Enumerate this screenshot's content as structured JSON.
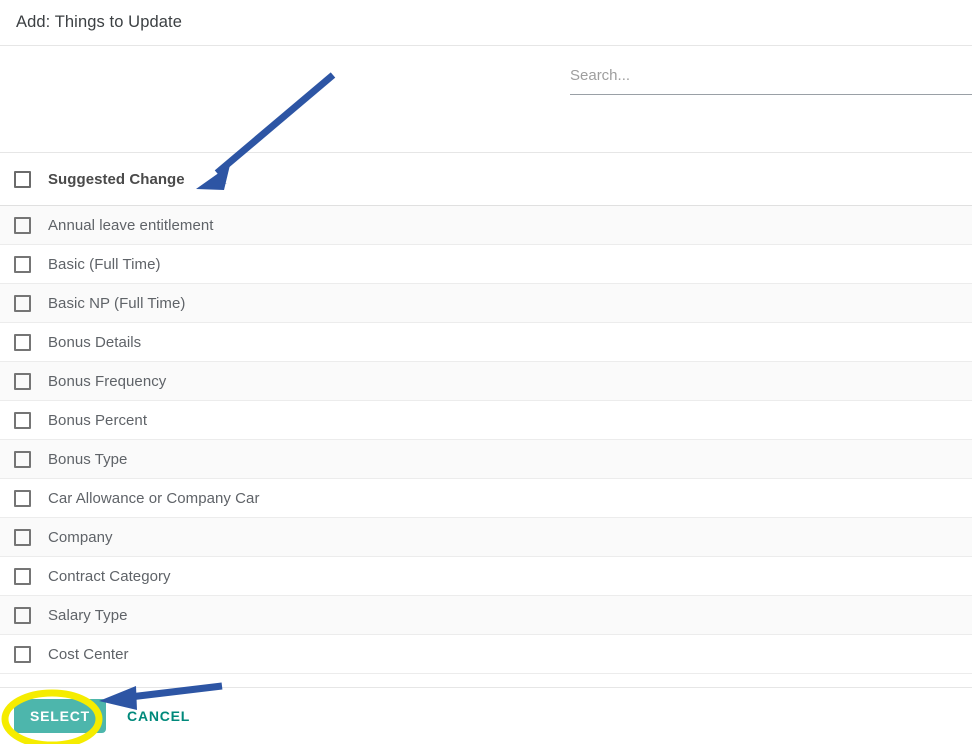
{
  "dialog": {
    "title": "Add: Things to Update"
  },
  "search": {
    "placeholder": "Search...",
    "value": ""
  },
  "table": {
    "header": {
      "label": "Suggested Change",
      "select_all_checked": false
    },
    "rows": [
      {
        "label": "Annual leave entitlement",
        "checked": false
      },
      {
        "label": "Basic (Full Time)",
        "checked": false
      },
      {
        "label": "Basic NP (Full Time)",
        "checked": false
      },
      {
        "label": "Bonus Details",
        "checked": false
      },
      {
        "label": "Bonus Frequency",
        "checked": false
      },
      {
        "label": "Bonus Percent",
        "checked": false
      },
      {
        "label": "Bonus Type",
        "checked": false
      },
      {
        "label": "Car Allowance or Company Car",
        "checked": false
      },
      {
        "label": "Company",
        "checked": false
      },
      {
        "label": "Contract Category",
        "checked": false
      },
      {
        "label": "Salary Type",
        "checked": false
      },
      {
        "label": "Cost Center",
        "checked": false
      }
    ]
  },
  "footer": {
    "select_label": "SELECT",
    "cancel_label": "CANCEL"
  },
  "annotations": {
    "arrow_color": "#2d55a4",
    "highlight_color": "#f5ec00",
    "arrow_to_header": "arrow-pointing-to-suggested-change-header",
    "arrow_to_select": "arrow-pointing-to-select-button",
    "ellipse_on_select": "yellow-ellipse-highlight-select-button"
  },
  "colors": {
    "accent_teal": "#4db6ac",
    "cancel_teal": "#00897b",
    "row_alt_bg": "#fafafa",
    "text_primary": "#3c4043",
    "text_secondary": "#5f6368"
  }
}
